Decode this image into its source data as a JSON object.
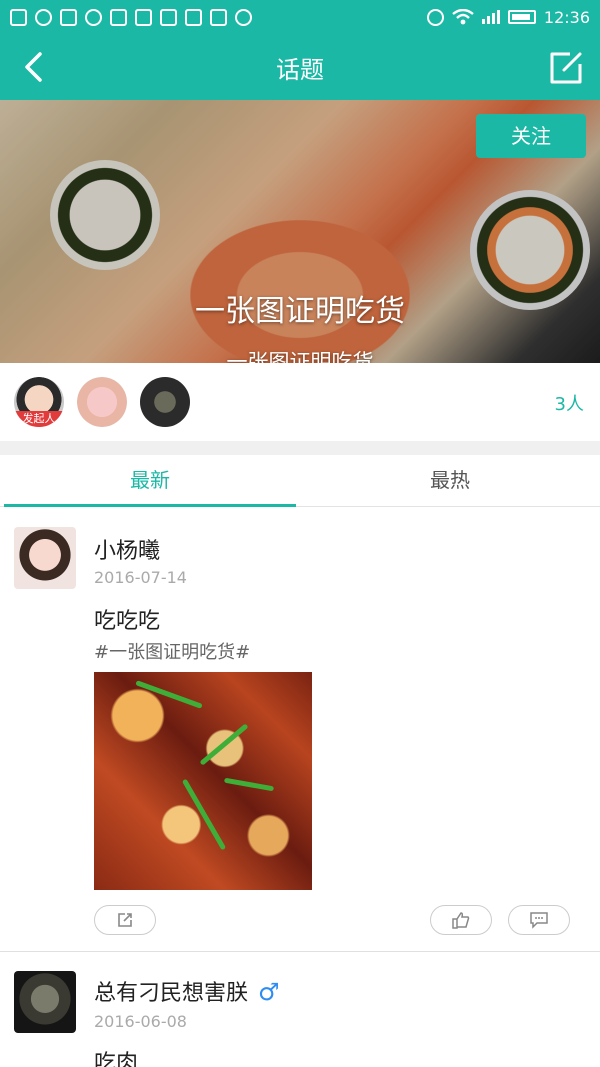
{
  "status_bar": {
    "time": "12:36",
    "left_icons": [
      "friend-icon",
      "qq-icon",
      "trash-icon",
      "wechat-icon",
      "calendar-icon",
      "gallery-icon",
      "map-icon",
      "apps-icon",
      "message-icon",
      "more-icon"
    ],
    "right_icons": [
      "alarm-icon",
      "wifi-icon",
      "signal-icon",
      "battery-icon"
    ]
  },
  "app_bar": {
    "title": "话题",
    "back_icon": "chevron-left-icon",
    "edit_icon": "edit-icon"
  },
  "banner": {
    "title": "一张图证明吃货",
    "subtitle": "一张图证明吃货",
    "follow_label": "关注"
  },
  "members": {
    "initiator_label": "发起人",
    "count_label": "3人"
  },
  "tabs": [
    {
      "label": "最新",
      "active": true
    },
    {
      "label": "最热",
      "active": false
    }
  ],
  "posts": [
    {
      "user": "小杨曦",
      "date": "2016-07-14",
      "text": "吃吃吃",
      "tag": "#一张图证明吃货#",
      "actions": [
        "share-icon",
        "like-icon",
        "comment-icon"
      ]
    },
    {
      "user": "总有刁民想害朕",
      "gender_icon": "male-icon",
      "gender_symbol": "♂",
      "date": "2016-06-08",
      "text": "吃肉"
    }
  ],
  "colors": {
    "accent": "#1cb8a6",
    "initiator_badge": "#e23b3b",
    "male": "#2f8cf2"
  }
}
